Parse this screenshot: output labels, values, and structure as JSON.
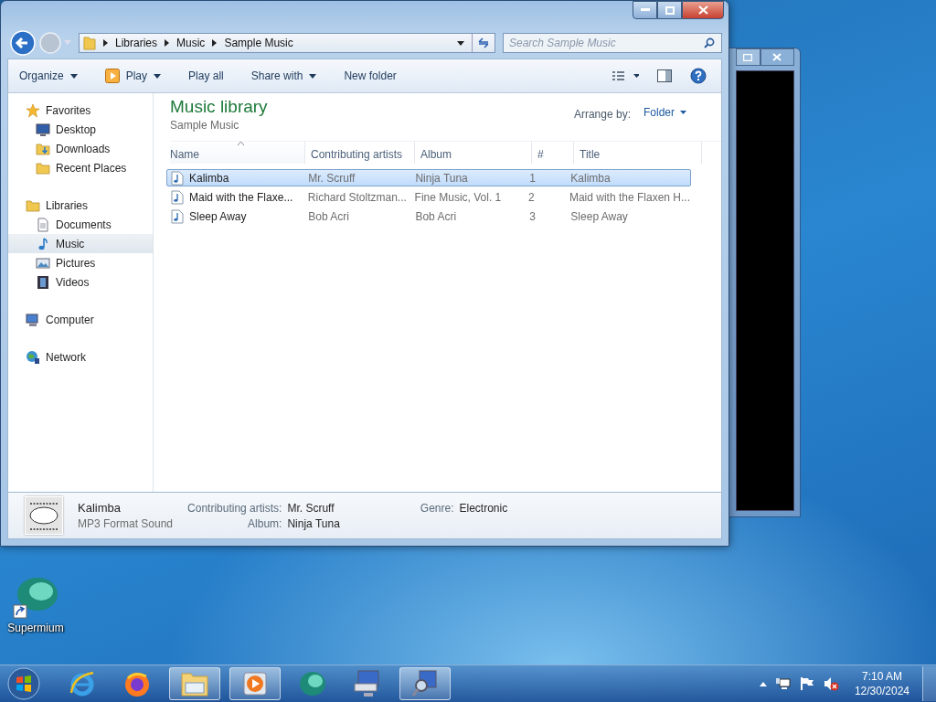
{
  "explorer": {
    "address": [
      "Libraries",
      "Music",
      "Sample Music"
    ],
    "search": {
      "placeholder": "Search Sample Music"
    },
    "toolbar": [
      {
        "label": "Organize",
        "kind": "menu"
      },
      {
        "label": "Play",
        "kind": "play-menu"
      },
      {
        "label": "Play all",
        "kind": "button"
      },
      {
        "label": "Share with",
        "kind": "menu"
      },
      {
        "label": "New folder",
        "kind": "button"
      }
    ],
    "nav": [
      {
        "label": "Favorites",
        "kind": "star",
        "selected": false,
        "children": [
          {
            "label": "Desktop",
            "kind": "desktop",
            "selected": false
          },
          {
            "label": "Downloads",
            "kind": "downloads",
            "selected": false
          },
          {
            "label": "Recent Places",
            "kind": "recent",
            "selected": false
          }
        ]
      },
      {
        "label": "Libraries",
        "kind": "libraries",
        "selected": false,
        "children": [
          {
            "label": "Documents",
            "kind": "documents",
            "selected": false
          },
          {
            "label": "Music",
            "kind": "music",
            "selected": true
          },
          {
            "label": "Pictures",
            "kind": "pictures",
            "selected": false
          },
          {
            "label": "Videos",
            "kind": "videos",
            "selected": false
          }
        ]
      },
      {
        "label": "Computer",
        "kind": "computer",
        "selected": false
      },
      {
        "label": "Network",
        "kind": "network",
        "selected": false
      }
    ],
    "library": {
      "title": "Music library",
      "subtitle": "Sample Music",
      "arrange_label": "Arrange by:",
      "arrange_value": "Folder"
    },
    "columns": [
      {
        "label": "Name",
        "sorted": true
      },
      {
        "label": "Contributing artists",
        "sorted": false
      },
      {
        "label": "Album",
        "sorted": false
      },
      {
        "label": "#",
        "sorted": false
      },
      {
        "label": "Title",
        "sorted": false
      }
    ],
    "rows": [
      {
        "cells": [
          "Kalimba",
          "Mr. Scruff",
          "Ninja Tuna",
          "1",
          "Kalimba"
        ],
        "selected": true
      },
      {
        "cells": [
          "Maid with the Flaxe...",
          "Richard Stoltzman...",
          "Fine Music, Vol. 1",
          "2",
          "Maid with the Flaxen H..."
        ],
        "selected": false
      },
      {
        "cells": [
          "Sleep Away",
          "Bob Acri",
          "Bob Acri",
          "3",
          "Sleep Away"
        ],
        "selected": false
      }
    ],
    "details": {
      "name": "Kalimba",
      "type": "MP3 Format Sound",
      "fields": [
        {
          "label": "Contributing artists:",
          "value": "Mr. Scruff"
        },
        {
          "label": "Album:",
          "value": "Ninja Tuna"
        },
        {
          "label": "Genre:",
          "value": "Electronic"
        }
      ]
    }
  },
  "desktop_icons": [
    {
      "label": "Supermium"
    }
  ],
  "taskbar": {
    "items": [
      {
        "kind": "start",
        "open": false
      },
      {
        "kind": "ie",
        "open": false
      },
      {
        "kind": "firefox",
        "open": false
      },
      {
        "kind": "explorer",
        "open": true
      },
      {
        "kind": "media-player",
        "open": true
      },
      {
        "kind": "supermium",
        "open": false
      },
      {
        "kind": "keyboard-monitor",
        "open": false
      },
      {
        "kind": "remote",
        "open": true
      }
    ],
    "time": "7:10 AM",
    "date": "12/30/2024"
  }
}
